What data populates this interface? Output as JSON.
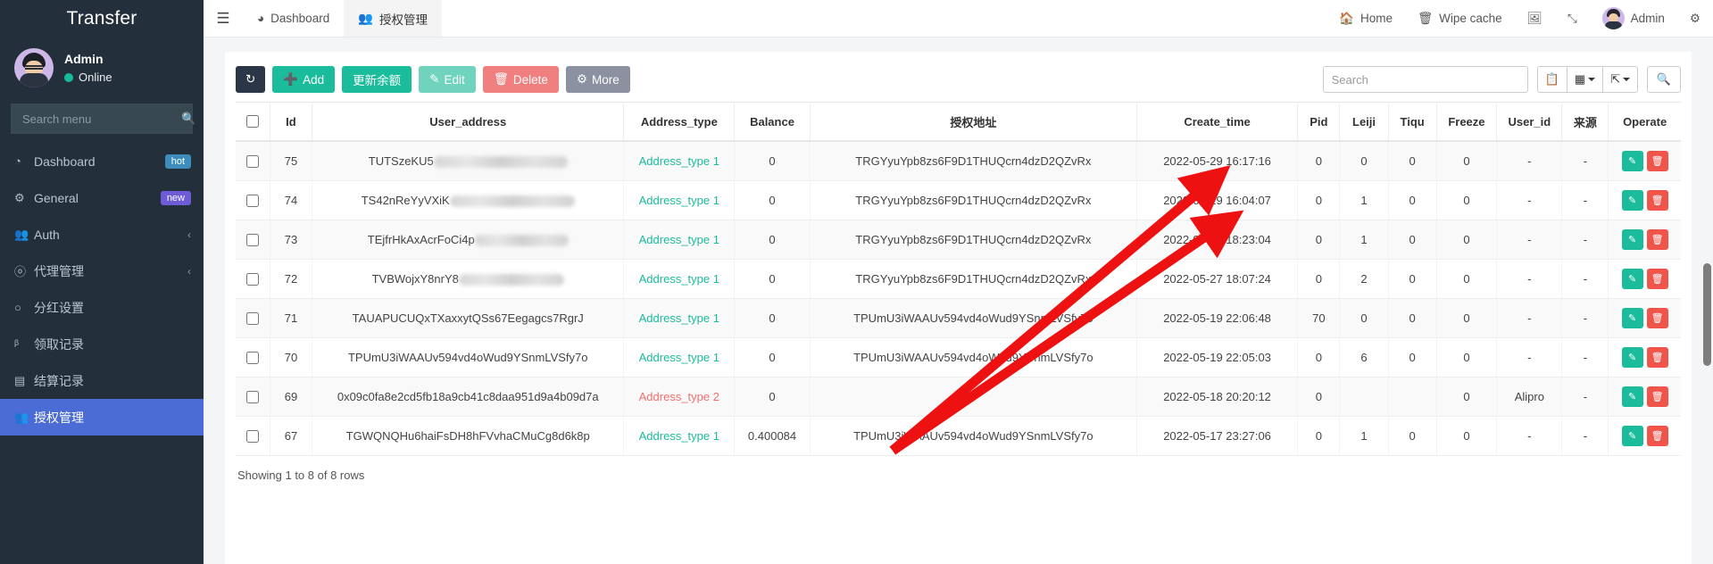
{
  "sidebar": {
    "brand": "Transfer",
    "user": {
      "name": "Admin",
      "status": "Online"
    },
    "search_placeholder": "Search menu",
    "search_value": "",
    "items": [
      {
        "label": "Dashboard",
        "icon": "dashboard-icon",
        "badge": "hot",
        "badge_type": "hot"
      },
      {
        "label": "General",
        "icon": "gears-icon",
        "badge": "new",
        "badge_type": "new"
      },
      {
        "label": "Auth",
        "icon": "users-icon",
        "badge": "",
        "chevron": "‹"
      },
      {
        "label": "代理管理",
        "icon": "user-circle-icon",
        "badge": "",
        "chevron": "‹"
      },
      {
        "label": "分红设置",
        "icon": "circle-icon",
        "badge": ""
      },
      {
        "label": "领取记录",
        "icon": "chart-icon",
        "badge": ""
      },
      {
        "label": "结算记录",
        "icon": "card-icon",
        "badge": ""
      },
      {
        "label": "授权管理",
        "icon": "users-icon",
        "badge": "",
        "active": true
      }
    ]
  },
  "topbar": {
    "hamburger": "☰",
    "tabs": [
      {
        "label": "Dashboard",
        "icon": "dashboard-icon",
        "active": false
      },
      {
        "label": "授权管理",
        "icon": "users-icon",
        "active": true
      }
    ],
    "right": [
      {
        "label": "Home",
        "icon": "home-icon"
      },
      {
        "label": "Wipe cache",
        "icon": "trash-icon"
      },
      {
        "label": "",
        "icon": "language-icon"
      },
      {
        "label": "",
        "icon": "fullscreen-icon"
      },
      {
        "label": "Admin",
        "icon": "avatar-icon"
      },
      {
        "label": "",
        "icon": "settings-gear-icon"
      }
    ]
  },
  "toolbar": {
    "refresh_label": "↻",
    "add_label": "Add",
    "update_balance_label": "更新余额",
    "edit_label": "Edit",
    "delete_label": "Delete",
    "more_label": "More",
    "search_placeholder": "Search",
    "search_value": "",
    "columns_icon": "columns-icon",
    "grid_icon": "grid-icon",
    "export_icon": "export-icon",
    "search_icon": "search-icon"
  },
  "table": {
    "columns": [
      "",
      "Id",
      "User_address",
      "Address_type",
      "Balance",
      "授权地址",
      "Create_time",
      "Pid",
      "Leiji",
      "Tiqu",
      "Freeze",
      "User_id",
      "来源",
      "Operate"
    ],
    "rows": [
      {
        "id": "75",
        "user_address": "TUTSzeKU5",
        "user_address_blurred": true,
        "blur_width": 150,
        "address_type": "Address_type 1",
        "address_type_kind": "1",
        "balance": "0",
        "auth_address": "TRGYyuYpb8zs6F9D1THUQcrn4dzD2QZvRx",
        "create_time": "2022-05-29 16:17:16",
        "pid": "0",
        "leiji": "0",
        "tiqu": "0",
        "freeze": "0",
        "user_id": "-",
        "source": "-"
      },
      {
        "id": "74",
        "user_address": "TS42nReYyVXiK",
        "user_address_blurred": true,
        "blur_width": 140,
        "address_type": "Address_type 1",
        "address_type_kind": "1",
        "balance": "0",
        "auth_address": "TRGYyuYpb8zs6F9D1THUQcrn4dzD2QZvRx",
        "create_time": "2022-05-29 16:04:07",
        "pid": "0",
        "leiji": "1",
        "tiqu": "0",
        "freeze": "0",
        "user_id": "-",
        "source": "-"
      },
      {
        "id": "73",
        "user_address": "TEjfrHkAxAcrFoCi4p",
        "user_address_blurred": true,
        "blur_width": 105,
        "address_type": "Address_type 1",
        "address_type_kind": "1",
        "balance": "0",
        "auth_address": "TRGYyuYpb8zs6F9D1THUQcrn4dzD2QZvRx",
        "create_time": "2022-05-27 18:23:04",
        "pid": "0",
        "leiji": "1",
        "tiqu": "0",
        "freeze": "0",
        "user_id": "-",
        "source": "-"
      },
      {
        "id": "72",
        "user_address": "TVBWojxY8nrY8",
        "user_address_blurred": true,
        "blur_width": 118,
        "address_type": "Address_type 1",
        "address_type_kind": "1",
        "balance": "0",
        "auth_address": "TRGYyuYpb8zs6F9D1THUQcrn4dzD2QZvRx",
        "create_time": "2022-05-27 18:07:24",
        "pid": "0",
        "leiji": "2",
        "tiqu": "0",
        "freeze": "0",
        "user_id": "-",
        "source": "-"
      },
      {
        "id": "71",
        "user_address": "TAUAPUCUQxTXaxxytQSs67Eegagcs7RgrJ",
        "user_address_blurred": false,
        "address_type": "Address_type 1",
        "address_type_kind": "1",
        "balance": "0",
        "auth_address": "TPUmU3iWAAUv594vd4oWud9YSnmLVSfy7o",
        "create_time": "2022-05-19 22:06:48",
        "pid": "70",
        "leiji": "0",
        "tiqu": "0",
        "freeze": "0",
        "user_id": "-",
        "source": "-"
      },
      {
        "id": "70",
        "user_address": "TPUmU3iWAAUv594vd4oWud9YSnmLVSfy7o",
        "user_address_blurred": false,
        "address_type": "Address_type 1",
        "address_type_kind": "1",
        "balance": "0",
        "auth_address": "TPUmU3iWAAUv594vd4oWud9YSnmLVSfy7o",
        "create_time": "2022-05-19 22:05:03",
        "pid": "0",
        "leiji": "6",
        "tiqu": "0",
        "freeze": "0",
        "user_id": "-",
        "source": "-"
      },
      {
        "id": "69",
        "user_address": "0x09c0fa8e2cd5fb18a9cb41c8daa951d9a4b09d7a",
        "user_address_blurred": false,
        "address_type": "Address_type 2",
        "address_type_kind": "2",
        "balance": "0",
        "auth_address": "-",
        "create_time": "2022-05-18 20:20:12",
        "pid": "0",
        "leiji": "",
        "tiqu": "",
        "freeze": "0",
        "user_id": "Alipro",
        "source": "-"
      },
      {
        "id": "67",
        "user_address": "TGWQNQHu6haiFsDH8hFVvhaCMuCg8d6k8p",
        "user_address_blurred": false,
        "address_type": "Address_type 1",
        "address_type_kind": "1",
        "balance": "0.400084",
        "auth_address": "TPUmU3iWAAUv594vd4oWud9YSnmLVSfy7o",
        "create_time": "2022-05-17 23:27:06",
        "pid": "0",
        "leiji": "1",
        "tiqu": "0",
        "freeze": "0",
        "user_id": "-",
        "source": "-"
      }
    ],
    "footer": "Showing 1 to 8 of 8 rows",
    "edit_icon": "pencil-icon",
    "delete_icon": "trash-icon"
  },
  "colors": {
    "sidebar_bg": "#242f3c",
    "active_menu": "#4a6cd4",
    "green": "#1abc9c",
    "red": "#f08080",
    "annotation_arrow": "#ee1111"
  }
}
